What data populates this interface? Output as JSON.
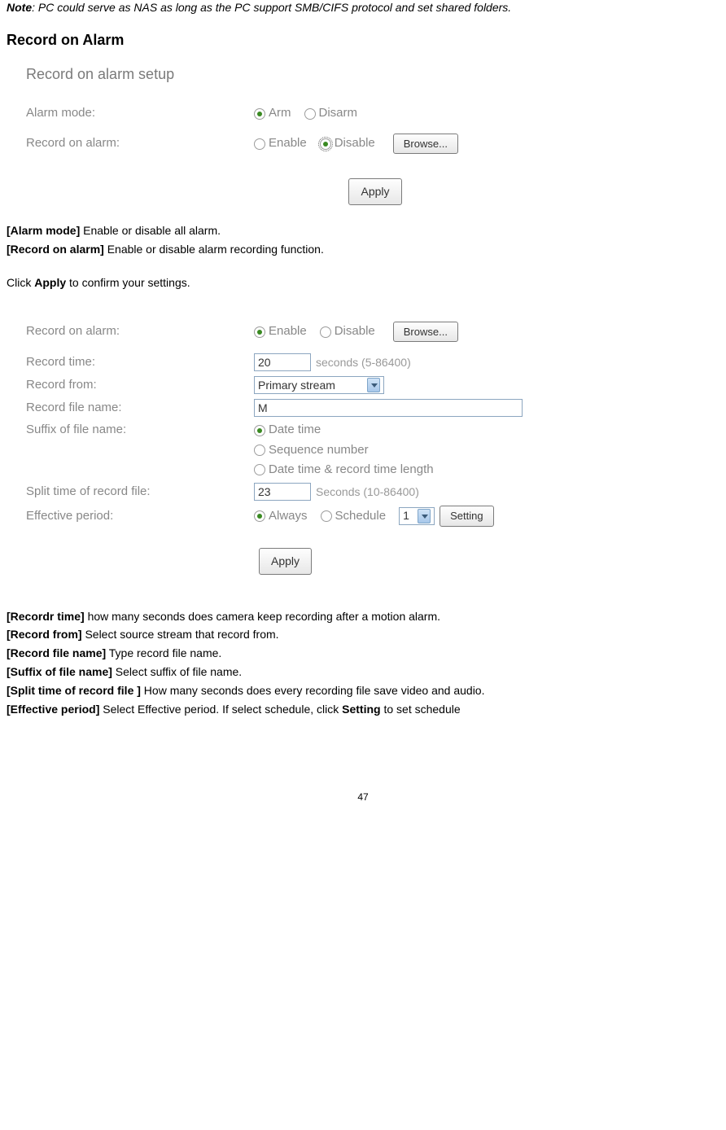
{
  "note": {
    "label": "Note",
    "text": ": PC could serve as NAS as long as the PC support SMB/CIFS protocol and set shared folders."
  },
  "section_title": "Record on Alarm",
  "shot1": {
    "title": "Record on alarm setup",
    "alarm_mode_label": "Alarm mode:",
    "arm": "Arm",
    "disarm": "Disarm",
    "record_on_alarm_label": "Record on alarm:",
    "enable": "Enable",
    "disable": "Disable",
    "browse": "Browse...",
    "apply": "Apply"
  },
  "desc1": {
    "alarm_mode_b": "[Alarm mode]",
    "alarm_mode_t": " Enable or disable all alarm.",
    "record_on_alarm_b": "[Record on alarm]",
    "record_on_alarm_t": " Enable or disable alarm recording function.",
    "apply_line_pre": "Click ",
    "apply_b": "Apply",
    "apply_line_post": " to confirm your settings."
  },
  "shot2": {
    "record_on_alarm_label": "Record on alarm:",
    "enable": "Enable",
    "disable": "Disable",
    "browse": "Browse...",
    "record_time_label": "Record time:",
    "record_time_value": "20",
    "record_time_hint": "seconds (5-86400)",
    "record_from_label": "Record from:",
    "record_from_value": "Primary stream",
    "file_name_label": "Record file name:",
    "file_name_value": "M",
    "suffix_label": "Suffix of file name:",
    "suffix_opt1": "Date time",
    "suffix_opt2": "Sequence number",
    "suffix_opt3": "Date time & record time length",
    "split_label": "Split time of record file:",
    "split_value": "23",
    "split_hint": "Seconds (10-86400)",
    "effective_label": "Effective period:",
    "eff_always": "Always",
    "eff_schedule": "Schedule",
    "eff_select_value": "1",
    "setting": "Setting",
    "apply": "Apply"
  },
  "desc2": {
    "rec_time_b": "[Recordr time]",
    "rec_time_t": " how many seconds does camera keep recording after a motion alarm.",
    "rec_from_b": "[Record from]",
    "rec_from_t": " Select source stream that record from.",
    "file_name_b": "[Record file name]",
    "file_name_t": " Type record file name.",
    "suffix_b": "[Suffix of file name]",
    "suffix_t": " Select suffix of file name.",
    "split_b": "[Split time of record file ]",
    "split_t": " How many seconds does every recording file save video and audio.",
    "eff_b": "[Effective period]",
    "eff_t_pre": " Select Effective period. If select schedule, click ",
    "eff_setting_b": "Setting",
    "eff_t_post": " to set schedule"
  },
  "page_number": "47"
}
